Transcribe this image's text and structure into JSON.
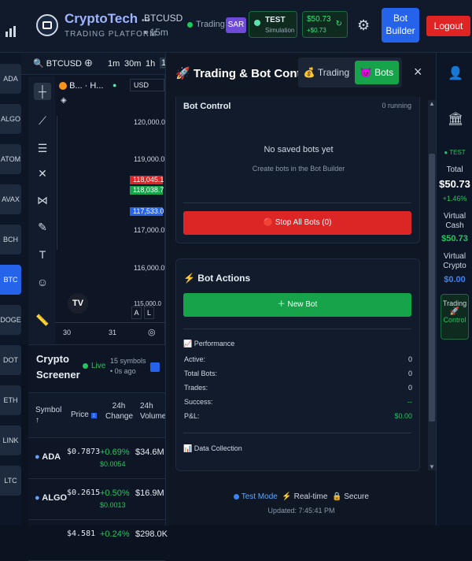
{
  "header": {
    "brand": "CryptoTech",
    "brand_dots": "•••",
    "subtitle": "TRADING PLATFORM",
    "pair": "BTCUSD",
    "timeframe": "• 15m",
    "trading_label": "Trading",
    "sar_label": "SAR",
    "test_label": "TEST",
    "simulation_label": "Simulation",
    "balance": "$50.73",
    "balance_change": "+$0.73",
    "refresh_glyph": "↻",
    "bot_builder_label": "Bot Builder",
    "logout_label": "Logout"
  },
  "symbols": [
    "ADA",
    "ALGO",
    "ATOM",
    "AVAX",
    "BCH",
    "BTC",
    "DOGE",
    "DOT",
    "ETH",
    "LINK",
    "LTC"
  ],
  "active_symbol": "BTC",
  "chart": {
    "symbol_search": "BTCUSD",
    "intervals": [
      "1m",
      "30m",
      "1h",
      "1"
    ],
    "legend_symbol": "B... · H...",
    "currency": "USD",
    "price_ticks": [
      "120,000.0",
      "119,000.0",
      "118,000.0",
      "117,000.0",
      "116,000.0",
      "115,000.0"
    ],
    "price_labels": [
      {
        "value": "118,045.1",
        "color": "#e02424"
      },
      {
        "value": "118,038.7",
        "color": "#16a34a"
      },
      {
        "value": "117,533.0",
        "color": "#2563eb"
      }
    ],
    "date_ticks": [
      "30",
      "31"
    ],
    "scale_buttons": [
      "A",
      "L"
    ],
    "logo": "TV"
  },
  "screener": {
    "title": "Crypto Screener",
    "live_label": "Live",
    "symbols_count": "15 symbols",
    "updated": "• 0s ago",
    "columns": [
      "Symbol ↑",
      "Price",
      "24h Change",
      "24h Volume"
    ],
    "rows": [
      {
        "symbol": "ADA",
        "price": "$0.7873",
        "change": "+0.69%",
        "change_abs": "$0.0054",
        "volume": "$34.6M"
      },
      {
        "symbol": "ALGO",
        "price": "$0.2615",
        "change": "+0.50%",
        "change_abs": "$0.0013",
        "volume": "$16.9M"
      },
      {
        "symbol": "",
        "price": "$4.581",
        "change": "+0.24%",
        "change_abs": "",
        "volume": "$298.0K"
      }
    ]
  },
  "panel": {
    "title": "🚀 Trading & Bot Control",
    "tab_trading": "💰 Trading",
    "tab_bots": "😈 Bots",
    "close": "×",
    "bot_control": {
      "title": "Bot Control",
      "running": "0 running",
      "empty_title": "No saved bots yet",
      "empty_sub": "Create bots in the Bot Builder",
      "stop_all": "🔴 Stop All Bots (0)"
    },
    "bot_actions": {
      "title": "⚡ Bot Actions",
      "new_bot": "＋ New Bot",
      "performance_title": "📈 Performance",
      "metrics": [
        {
          "label": "Active:",
          "value": "0"
        },
        {
          "label": "Total Bots:",
          "value": "0"
        },
        {
          "label": "Trades:",
          "value": "0"
        },
        {
          "label": "Success:",
          "value": "--"
        },
        {
          "label": "P&L:",
          "value": "$0.00"
        }
      ],
      "data_collection": "📊 Data Collection"
    },
    "footer": {
      "test_mode": "Test Mode",
      "realtime": "Real-time",
      "secure": "Secure",
      "updated": "Updated: 7:45:41 PM"
    }
  },
  "right_sidebar": {
    "test_label": "TEST",
    "total_label": "Total",
    "total_value": "$50.73",
    "total_change": "+1.46%",
    "virtual_cash_label": "Virtual Cash",
    "virtual_cash_value": "$50.73",
    "virtual_crypto_label": "Virtual Crypto",
    "virtual_crypto_value": "$0.00",
    "trading_control_label": "Trading",
    "trading_control_label2": "Control"
  },
  "colors": {
    "accent": "#2563eb",
    "green": "#16a34a",
    "red": "#e02424",
    "bg": "#0b1220"
  }
}
